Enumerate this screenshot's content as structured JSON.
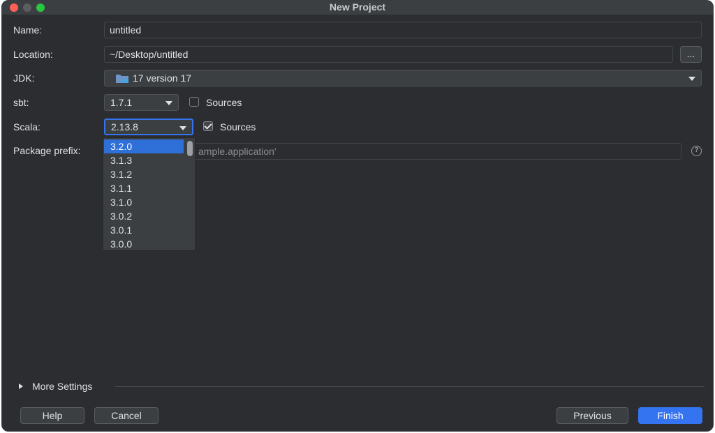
{
  "window": {
    "title": "New Project"
  },
  "form": {
    "name_label": "Name:",
    "name_value": "untitled",
    "location_label": "Location:",
    "location_value": "~/Desktop/untitled",
    "browse_label": "...",
    "jdk_label": "JDK:",
    "jdk_value": "17 version 17",
    "sbt_label": "sbt:",
    "sbt_value": "1.7.1",
    "sbt_sources_label": "Sources",
    "sbt_sources_checked": false,
    "scala_label": "Scala:",
    "scala_value": "2.13.8",
    "scala_sources_label": "Sources",
    "scala_sources_checked": true,
    "package_prefix_label": "Package prefix:",
    "package_prefix_value": "ample.application'"
  },
  "scala_dropdown": {
    "options": [
      "3.2.0",
      "3.1.3",
      "3.1.2",
      "3.1.1",
      "3.1.0",
      "3.0.2",
      "3.0.1",
      "3.0.0"
    ],
    "selected": "3.2.0"
  },
  "more_settings": {
    "label": "More Settings"
  },
  "buttons": {
    "help": "Help",
    "cancel": "Cancel",
    "previous": "Previous",
    "finish": "Finish"
  },
  "colors": {
    "background": "#2b2d30",
    "accent": "#3574f0",
    "selection": "#2e6fd8"
  },
  "icons": {
    "help": "question-circle-icon",
    "jdk": "folder-icon",
    "dropdown": "chevron-down-icon",
    "expand": "triangle-right-icon"
  }
}
